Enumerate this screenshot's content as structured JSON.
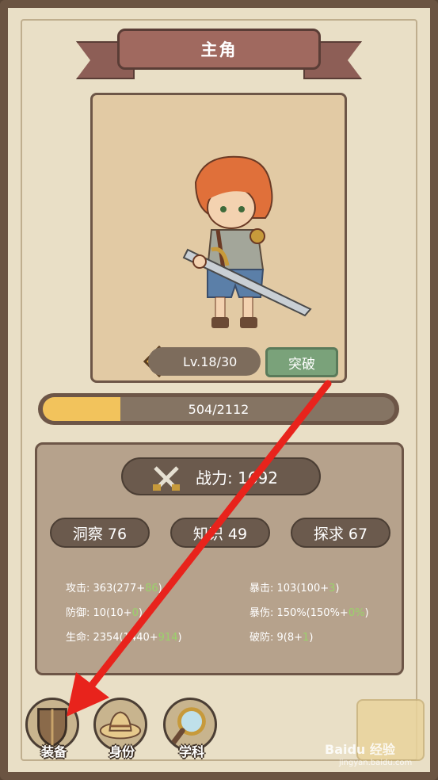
{
  "header": {
    "title": "主角"
  },
  "hero": {
    "level_text": "Lv.18/30",
    "level_badge": "Lv",
    "break_label": "突破"
  },
  "exp": {
    "text": "504/2112",
    "fraction": 0.22
  },
  "stats": {
    "power": "战力: 1692",
    "attributes": [
      {
        "label": "洞察 76"
      },
      {
        "label": "知识 49"
      },
      {
        "label": "探求 67"
      }
    ],
    "left": [
      {
        "base": "攻击: 363(277+",
        "bonus": "86",
        "end": ")"
      },
      {
        "base": "防御: 10(10+",
        "bonus": "0",
        "end": ")"
      },
      {
        "base": "生命: 2354(1440+",
        "bonus": "914",
        "end": ")"
      }
    ],
    "right": [
      {
        "base": "暴击: 103(100+",
        "bonus": "3",
        "end": ")"
      },
      {
        "base": "暴伤: 150%(150%+",
        "bonus": "0%",
        "end": ")"
      },
      {
        "base": "破防: 9(8+",
        "bonus": "1",
        "end": ")"
      }
    ]
  },
  "nav": [
    {
      "label": "装备",
      "icon": "shield-icon"
    },
    {
      "label": "身份",
      "icon": "hat-icon"
    },
    {
      "label": "学科",
      "icon": "magnifier-icon"
    }
  ],
  "watermark": {
    "brand": "Baidu 经验",
    "url": "jingyan.baidu.com"
  },
  "colors": {
    "accent": "#f2c35c",
    "arrow": "#e8231c",
    "confirm": "#7aa27a"
  }
}
